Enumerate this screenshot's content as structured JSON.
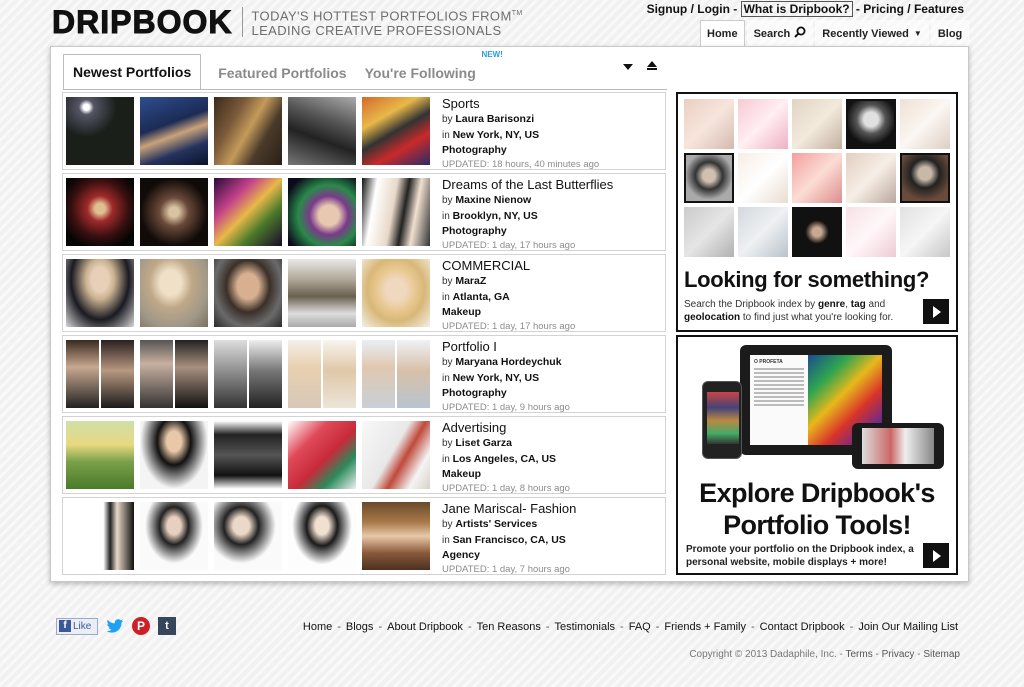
{
  "logo": {
    "word": "DRIPBOOK",
    "tagline_line1": "TODAY'S HOTTEST PORTFOLIOS FROM",
    "tagline_tm": "TM",
    "tagline_line2": "LEADING CREATIVE PROFESSIONALS"
  },
  "toplinks": {
    "signup": "Signup",
    "sep1": " / ",
    "login": "Login",
    "sep2": " - ",
    "what": "What is Dripbook?",
    "sep3": " - ",
    "pricing": "Pricing",
    "sep4": " / ",
    "features": "Features"
  },
  "navtabs": {
    "home": "Home",
    "search": "Search",
    "recent": "Recently Viewed",
    "blog": "Blog"
  },
  "tabs": {
    "newest": "Newest Portfolios",
    "featured": "Featured Portfolios",
    "following": "You're Following",
    "new_badge": "NEW!"
  },
  "portfolios": [
    {
      "title": "Sports",
      "by": "by",
      "author": "Laura Barisonzi",
      "in": "in",
      "location": "New York, NY, US",
      "category": "Photography",
      "updated": "UPDATED: 18 hours, 40 minutes ago"
    },
    {
      "title": "Dreams of the Last Butterflies",
      "by": "by",
      "author": "Maxine Nienow",
      "in": "in",
      "location": "Brooklyn, NY, US",
      "category": "Photography",
      "updated": "UPDATED: 1 day, 17 hours ago"
    },
    {
      "title": "COMMERCIAL",
      "by": "by",
      "author": "MaraZ",
      "in": "in",
      "location": "Atlanta, GA",
      "category": "Makeup",
      "updated": "UPDATED: 1 day, 17 hours ago"
    },
    {
      "title": "Portfolio I",
      "by": "by",
      "author": "Maryana Hordeychuk",
      "in": "in",
      "location": "New York, NY, US",
      "category": "Photography",
      "updated": "UPDATED: 1 day, 9 hours ago"
    },
    {
      "title": "Advertising",
      "by": "by",
      "author": "Liset Garza",
      "in": "in",
      "location": "Los Angeles, CA, US",
      "category": "Makeup",
      "updated": "UPDATED: 1 day, 8 hours ago"
    },
    {
      "title": "Jane Mariscal- Fashion",
      "by": "by",
      "author": "Artists' Services",
      "in": "in",
      "location": "San Francisco, CA, US",
      "category": "Agency",
      "updated": "UPDATED: 1 day, 7 hours ago"
    }
  ],
  "ads": {
    "search": {
      "headline": "Looking for something?",
      "sub_a": "Search the Dripbook index by ",
      "sub_genre": "genre",
      "sub_b": ", ",
      "sub_tag": "tag",
      "sub_c": " and ",
      "sub_geo": "geolocation",
      "sub_d": " to find just what you're looking for."
    },
    "tools": {
      "line1": "Explore Dripbook's",
      "line2": "Portfolio Tools!",
      "sub": "Promote your portfolio on the Dripbook index, a personal website, mobile displays + more!",
      "mag_header": "O PROFETA"
    }
  },
  "social": {
    "fb_letter": "f",
    "like": "Like",
    "pin_letter": "P",
    "tumblr_letter": "t"
  },
  "footer": {
    "links": [
      "Home",
      "Blogs",
      "About Dripbook",
      "Ten Reasons",
      "Testimonials",
      "FAQ",
      "Friends + Family",
      "Contact Dripbook",
      "Join Our Mailing List"
    ],
    "copyright": "Copyright © 2013 Dadaphile, Inc.",
    "terms": "Terms",
    "privacy": "Privacy",
    "sitemap": "Sitemap"
  },
  "colors": {
    "accent": "#2aa0d8",
    "panel_border": "#111111",
    "facebook": "#3b5998",
    "pinterest": "#cb2027",
    "tumblr": "#36465d",
    "twitter": "#1da1f2"
  }
}
